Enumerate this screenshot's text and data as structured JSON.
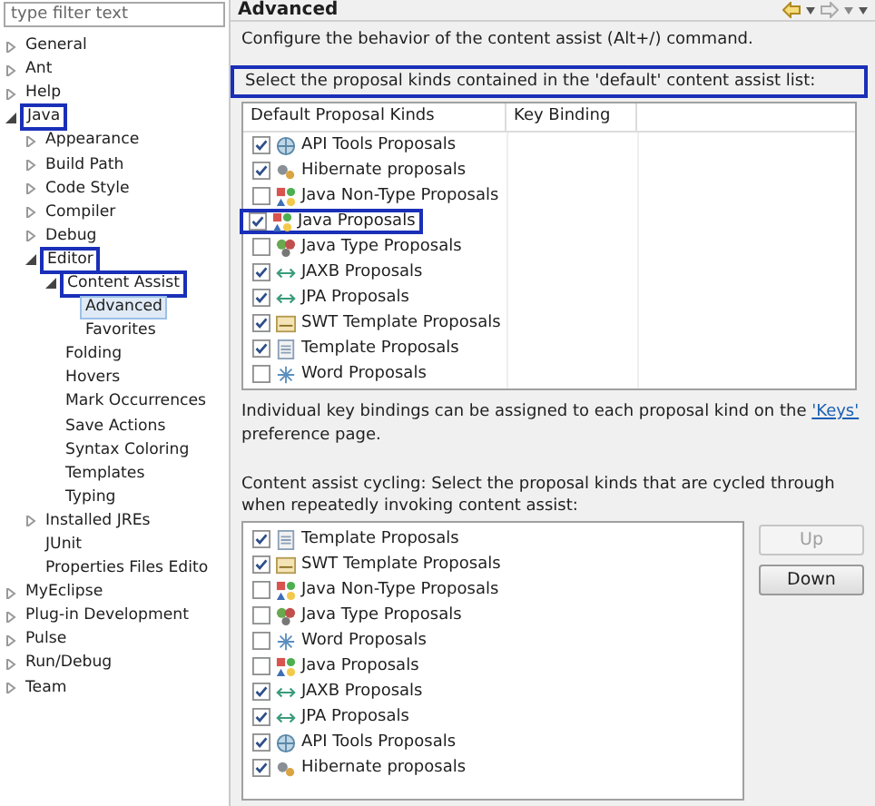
{
  "filter": {
    "placeholder": "type filter text"
  },
  "tree": [
    {
      "label": "General",
      "expanded": false,
      "selected": false,
      "boxed": false
    },
    {
      "label": "Ant",
      "expanded": false,
      "selected": false,
      "boxed": false
    },
    {
      "label": "Help",
      "expanded": false,
      "selected": false,
      "boxed": false
    },
    {
      "label": "Java",
      "expanded": true,
      "selected": false,
      "boxed": true,
      "children": [
        {
          "label": "Appearance",
          "expanded": false,
          "selected": false,
          "boxed": false
        },
        {
          "label": "Build Path",
          "expanded": false,
          "selected": false,
          "boxed": false
        },
        {
          "label": "Code Style",
          "expanded": false,
          "selected": false,
          "boxed": false
        },
        {
          "label": "Compiler",
          "expanded": false,
          "selected": false,
          "boxed": false
        },
        {
          "label": "Debug",
          "expanded": false,
          "selected": false,
          "boxed": false
        },
        {
          "label": "Editor",
          "expanded": true,
          "selected": false,
          "boxed": true,
          "children": [
            {
              "label": "Content Assist",
              "expanded": true,
              "selected": false,
              "boxed": true,
              "children": [
                {
                  "label": "Advanced",
                  "selected": true,
                  "boxed": false
                },
                {
                  "label": "Favorites",
                  "selected": false,
                  "boxed": false
                }
              ]
            },
            {
              "label": "Folding",
              "selected": false,
              "boxed": false
            },
            {
              "label": "Hovers",
              "selected": false,
              "boxed": false
            },
            {
              "label": "Mark Occurrences",
              "selected": false,
              "boxed": false
            },
            {
              "label": "Save Actions",
              "selected": false,
              "boxed": false
            },
            {
              "label": "Syntax Coloring",
              "selected": false,
              "boxed": false
            },
            {
              "label": "Templates",
              "selected": false,
              "boxed": false
            },
            {
              "label": "Typing",
              "selected": false,
              "boxed": false
            }
          ]
        },
        {
          "label": "Installed JREs",
          "expanded": false,
          "selected": false,
          "boxed": false
        },
        {
          "label": "JUnit",
          "selected": false,
          "boxed": false
        },
        {
          "label": "Properties Files Edito",
          "selected": false,
          "boxed": false
        }
      ]
    },
    {
      "label": "MyEclipse",
      "expanded": false,
      "selected": false,
      "boxed": false
    },
    {
      "label": "Plug-in Development",
      "expanded": false,
      "selected": false,
      "boxed": false
    },
    {
      "label": "Pulse",
      "expanded": false,
      "selected": false,
      "boxed": false
    },
    {
      "label": "Run/Debug",
      "expanded": false,
      "selected": false,
      "boxed": false
    },
    {
      "label": "Team",
      "expanded": false,
      "selected": false,
      "boxed": false
    }
  ],
  "page": {
    "title": "Advanced",
    "description": "Configure the behavior of the content assist (Alt+/) command."
  },
  "default_list": {
    "label": "Select the proposal kinds contained in the 'default' content assist list:",
    "boxed": true,
    "columns": [
      "Default Proposal Kinds",
      "Key Binding"
    ],
    "rows": [
      {
        "name": "API Tools Proposals",
        "kind": "api",
        "checked": true,
        "boxed": false
      },
      {
        "name": "Hibernate proposals",
        "kind": "hibernate",
        "checked": true,
        "boxed": false
      },
      {
        "name": "Java Non-Type Proposals",
        "kind": "java",
        "checked": false,
        "boxed": false
      },
      {
        "name": "Java Proposals",
        "kind": "java",
        "checked": true,
        "boxed": true
      },
      {
        "name": "Java Type Proposals",
        "kind": "type",
        "checked": false,
        "boxed": false
      },
      {
        "name": "JAXB Proposals",
        "kind": "mapping",
        "checked": true,
        "boxed": false
      },
      {
        "name": "JPA Proposals",
        "kind": "mapping",
        "checked": true,
        "boxed": false
      },
      {
        "name": "SWT Template Proposals",
        "kind": "swt",
        "checked": true,
        "boxed": false
      },
      {
        "name": "Template Proposals",
        "kind": "template",
        "checked": true,
        "boxed": false
      },
      {
        "name": "Word Proposals",
        "kind": "word",
        "checked": false,
        "boxed": false
      }
    ]
  },
  "keys_note": {
    "before": "Individual key bindings can be assigned to each proposal kind on the ",
    "link": "'Keys'",
    "after": " preference page."
  },
  "cycling": {
    "label": "Content assist cycling: Select the proposal kinds that are cycled through when repeatedly invoking content assist:",
    "rows": [
      {
        "name": "Template Proposals",
        "kind": "template",
        "checked": true
      },
      {
        "name": "SWT Template Proposals",
        "kind": "swt",
        "checked": true
      },
      {
        "name": "Java Non-Type Proposals",
        "kind": "java",
        "checked": false
      },
      {
        "name": "Java Type Proposals",
        "kind": "type",
        "checked": false
      },
      {
        "name": "Word Proposals",
        "kind": "word",
        "checked": false
      },
      {
        "name": "Java Proposals",
        "kind": "java",
        "checked": false
      },
      {
        "name": "JAXB Proposals",
        "kind": "mapping",
        "checked": true
      },
      {
        "name": "JPA Proposals",
        "kind": "mapping",
        "checked": true
      },
      {
        "name": "API Tools Proposals",
        "kind": "api",
        "checked": true
      },
      {
        "name": "Hibernate proposals",
        "kind": "hibernate",
        "checked": true
      }
    ]
  },
  "buttons": [
    {
      "label": "Up",
      "disabled": true
    },
    {
      "label": "Down",
      "disabled": false
    }
  ]
}
